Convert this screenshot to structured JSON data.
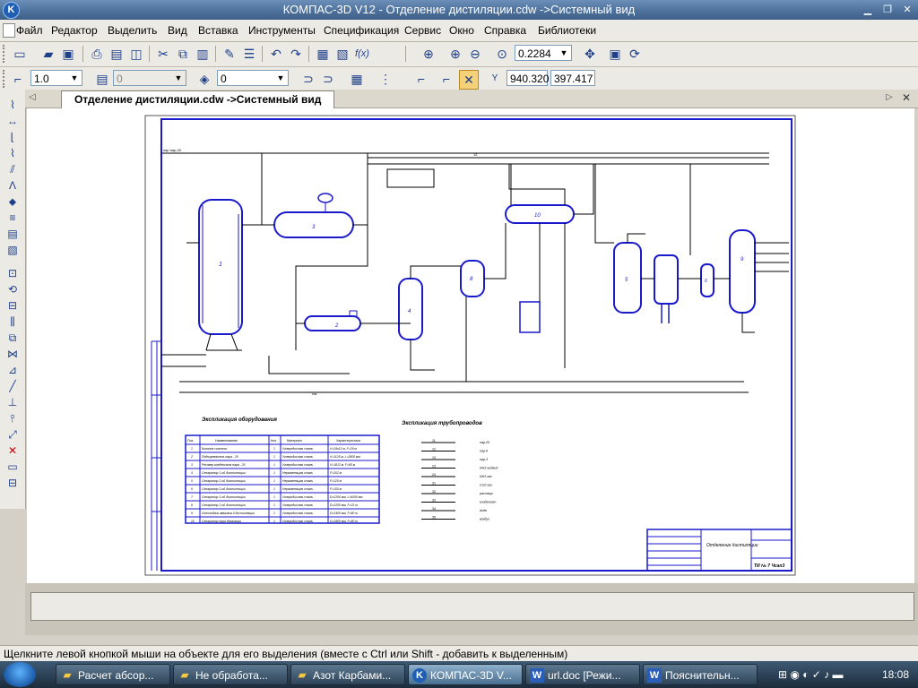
{
  "window": {
    "title": "КОМПАС-3D V12 - Отделение дистиляции.cdw ->Системный вид",
    "app_icon": "K"
  },
  "menu": [
    "Файл",
    "Редактор",
    "Выделить",
    "Вид",
    "Вставка",
    "Инструменты",
    "Спецификация",
    "Сервис",
    "Окно",
    "Справка",
    "Библиотеки"
  ],
  "toolbar": {
    "zoom_value": "0.2284",
    "line_width": "1.0",
    "layer_disabled": "0",
    "layer_value": "0",
    "coord_x": "940.320",
    "coord_y": "397.417"
  },
  "tab": {
    "label": "Отделение дистиляции.cdw ->Системный вид"
  },
  "status": {
    "hint": "Щелкните левой кнопкой мыши на объекте для его выделения (вместе с Ctrl или Shift - добавить к выделенным)"
  },
  "taskbar": {
    "items": [
      "Расчет абсор...",
      "Не обработа...",
      "Азот Карбами...",
      "КОМПАС-3D V...",
      "url.doc [Режи...",
      "Пояснительн..."
    ],
    "clock": "18:08"
  },
  "drawing": {
    "equipment_title": "Экспликация оборудования",
    "pipes_title": "Экспликация трубопроводов",
    "stamp_title": "Отделение дистиляции",
    "table_headers": [
      "Поз.",
      "Наименование",
      "Кол.",
      "Материал",
      "Характеристика"
    ],
    "table_rows": [
      [
        "1",
        "Колонна синтеза",
        "1",
        "Углеродистая сталь",
        "V=24х12 м, F=26 м"
      ],
      [
        "2",
        "Подогреватель пара - 20",
        "1",
        "Углеродистая сталь",
        "V=1125 м, L=2800 мм"
      ],
      [
        "3",
        "Ресивер конденсата пара - 20",
        "1",
        "Углеродистая сталь",
        "V=1813 м, F=85 м"
      ],
      [
        "4",
        "Сепаратор 1-ой дистилляции",
        "1",
        "Нержавеющая сталь",
        "F=202 м"
      ],
      [
        "5",
        "Сепаратор 2-ой дистилляции",
        "1",
        "Нержавеющая сталь",
        "F=120 м"
      ],
      [
        "6",
        "Сепаратор 2-ой дистилляции",
        "1",
        "Нержавеющая сталь",
        "F=100 м"
      ],
      [
        "7",
        "Сепаратор 1-ой дистилляции",
        "1",
        "Углеродистая сталь",
        "D=2200 мм, L=6000 мм"
      ],
      [
        "8",
        "Сепаратор 2-ой дистилляции",
        "1",
        "Углеродистая сталь",
        "D=2200 мм, F=22 м"
      ],
      [
        "9",
        "Отстойник аммиака II дистилляции",
        "1",
        "Углеродистая сталь",
        "D=2400 мм, F=80 м"
      ],
      [
        "10",
        "Сепаратор пара дегазации",
        "1",
        "Углеродистая сталь",
        "D=2800 мм, F=80 м"
      ]
    ],
    "pipe_codes": [
      "11",
      "12",
      "13",
      "23",
      "24",
      "31",
      "32",
      "33",
      "34",
      "35"
    ],
    "pipe_labels": [
      "пар-20",
      "пар-6",
      "пар-3",
      "NH3 жидкий",
      "NH3 газ",
      "CO2 газ",
      "раствор",
      "конденсат",
      "вода",
      "воздух"
    ],
    "equipment_numbers": [
      "1",
      "2",
      "3",
      "4",
      "5",
      "6",
      "7",
      "8",
      "9",
      "10"
    ],
    "stamp_code": "ТИ № 7 Чсап3"
  }
}
